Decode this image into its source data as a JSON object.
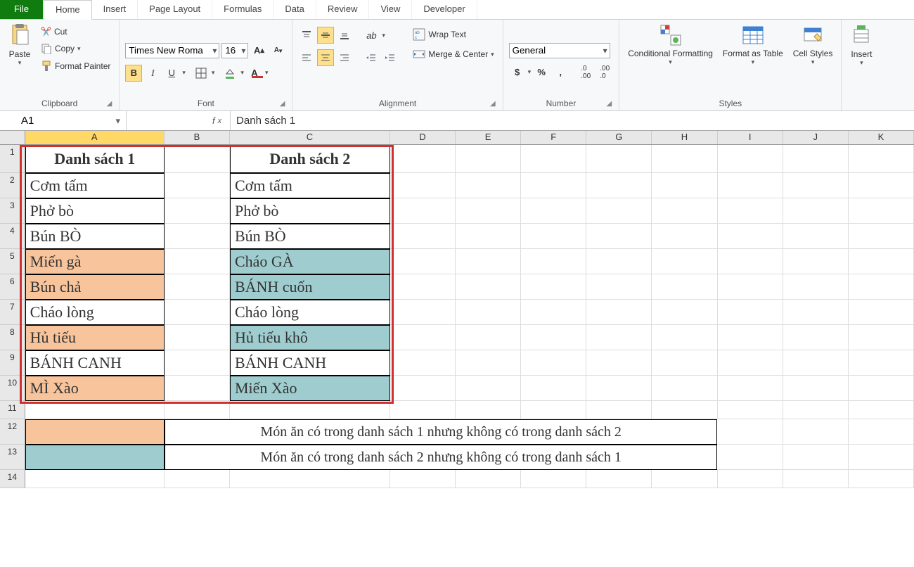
{
  "tabs": {
    "file": "File",
    "home": "Home",
    "insert": "Insert",
    "pagelayout": "Page Layout",
    "formulas": "Formulas",
    "data": "Data",
    "review": "Review",
    "view": "View",
    "developer": "Developer"
  },
  "ribbon": {
    "clipboard": {
      "label": "Clipboard",
      "paste": "Paste",
      "cut": "Cut",
      "copy": "Copy",
      "formatpainter": "Format Painter"
    },
    "font": {
      "label": "Font",
      "name": "Times New Roma",
      "size": "16"
    },
    "alignment": {
      "label": "Alignment",
      "wrap": "Wrap Text",
      "merge": "Merge & Center"
    },
    "number": {
      "label": "Number",
      "format": "General"
    },
    "styles": {
      "label": "Styles",
      "cond": "Conditional Formatting",
      "table": "Format as Table",
      "cell": "Cell Styles"
    },
    "cells": {
      "insert": "Insert"
    }
  },
  "formula": {
    "name": "A1",
    "value": "Danh sách 1"
  },
  "columns": [
    "A",
    "B",
    "C",
    "D",
    "E",
    "F",
    "G",
    "H",
    "I",
    "J",
    "K"
  ],
  "colwidths": {
    "A": 200,
    "B": 94,
    "C": 230,
    "D": 94,
    "E": 94,
    "F": 94,
    "G": 94,
    "H": 94,
    "I": 94,
    "J": 94,
    "K": 94
  },
  "sheet": {
    "headers": {
      "A": "Danh sách 1",
      "C": "Danh sách 2"
    },
    "listA": [
      {
        "t": "Cơm tấm",
        "c": ""
      },
      {
        "t": "Phở bò",
        "c": ""
      },
      {
        "t": "Bún BÒ",
        "c": ""
      },
      {
        "t": "Miến gà",
        "c": "o"
      },
      {
        "t": "Bún chả",
        "c": "o"
      },
      {
        "t": "Cháo lòng",
        "c": ""
      },
      {
        "t": "Hủ tiếu",
        "c": "o"
      },
      {
        "t": "BÁNH CANH",
        "c": ""
      },
      {
        "t": "MÌ Xào",
        "c": "o"
      }
    ],
    "listC": [
      {
        "t": "Cơm tấm",
        "c": ""
      },
      {
        "t": "Phở bò",
        "c": ""
      },
      {
        "t": "Bún BÒ",
        "c": ""
      },
      {
        "t": "Cháo GÀ",
        "c": "b"
      },
      {
        "t": "BÁNH cuốn",
        "c": "b"
      },
      {
        "t": "Cháo lòng",
        "c": ""
      },
      {
        "t": "Hủ tiếu khô",
        "c": "b"
      },
      {
        "t": "BÁNH CANH",
        "c": ""
      },
      {
        "t": "Miến Xào",
        "c": "b"
      }
    ],
    "legend": [
      {
        "color": "o",
        "text": "Món ăn có trong danh sách 1 nhưng không có trong danh sách 2"
      },
      {
        "color": "b",
        "text": "Món ăn có trong danh sách 2 nhưng không có trong danh sách 1"
      }
    ]
  }
}
